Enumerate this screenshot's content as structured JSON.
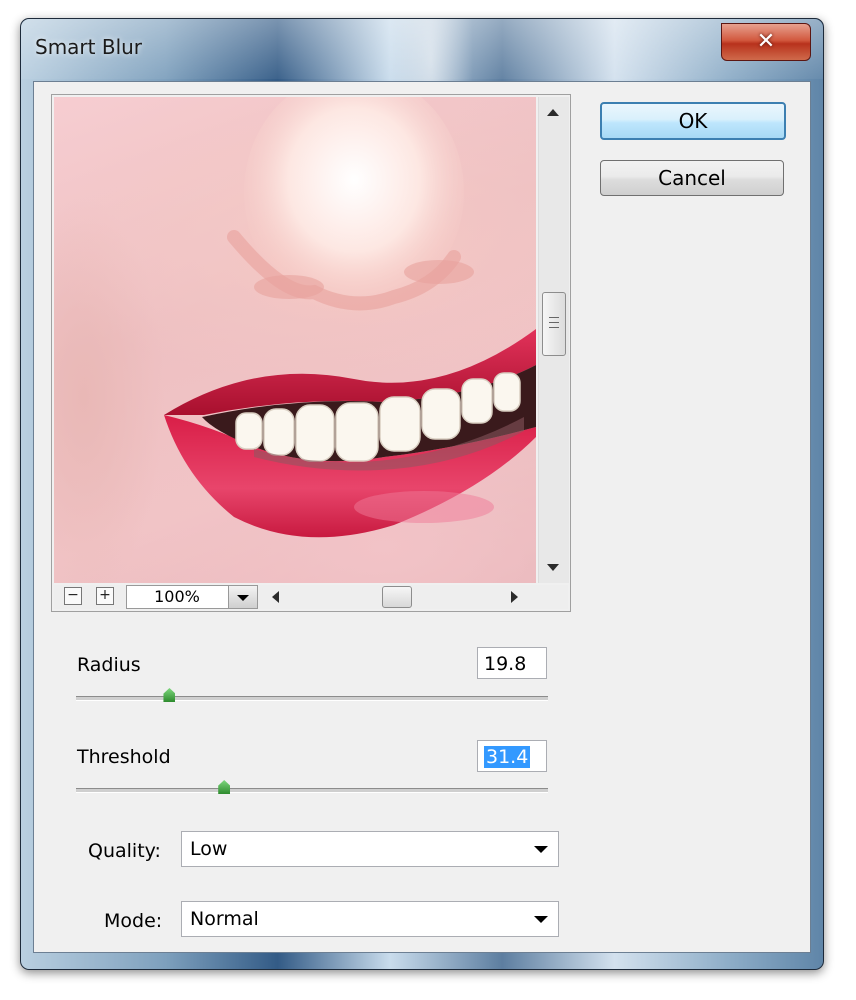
{
  "window": {
    "title": "Smart Blur",
    "close_symbol": "✕"
  },
  "buttons": {
    "ok": "OK",
    "cancel": "Cancel"
  },
  "preview": {
    "zoom_out_symbol": "−",
    "zoom_in_symbol": "+",
    "zoom_value": "100%",
    "vertical_scroll_position": 0.45,
    "horizontal_scroll_position": 0.48
  },
  "radius": {
    "label": "Radius",
    "value": "19.8",
    "slider_fraction": 0.198
  },
  "threshold": {
    "label": "Threshold",
    "value": "31.4",
    "slider_fraction": 0.314
  },
  "quality": {
    "label": "Quality:",
    "selected": "Low"
  },
  "mode": {
    "label": "Mode:",
    "selected": "Normal"
  },
  "colors": {
    "accent": "#3399ff",
    "ok_border": "#3c7fb1",
    "close_red": "#c8452b"
  }
}
